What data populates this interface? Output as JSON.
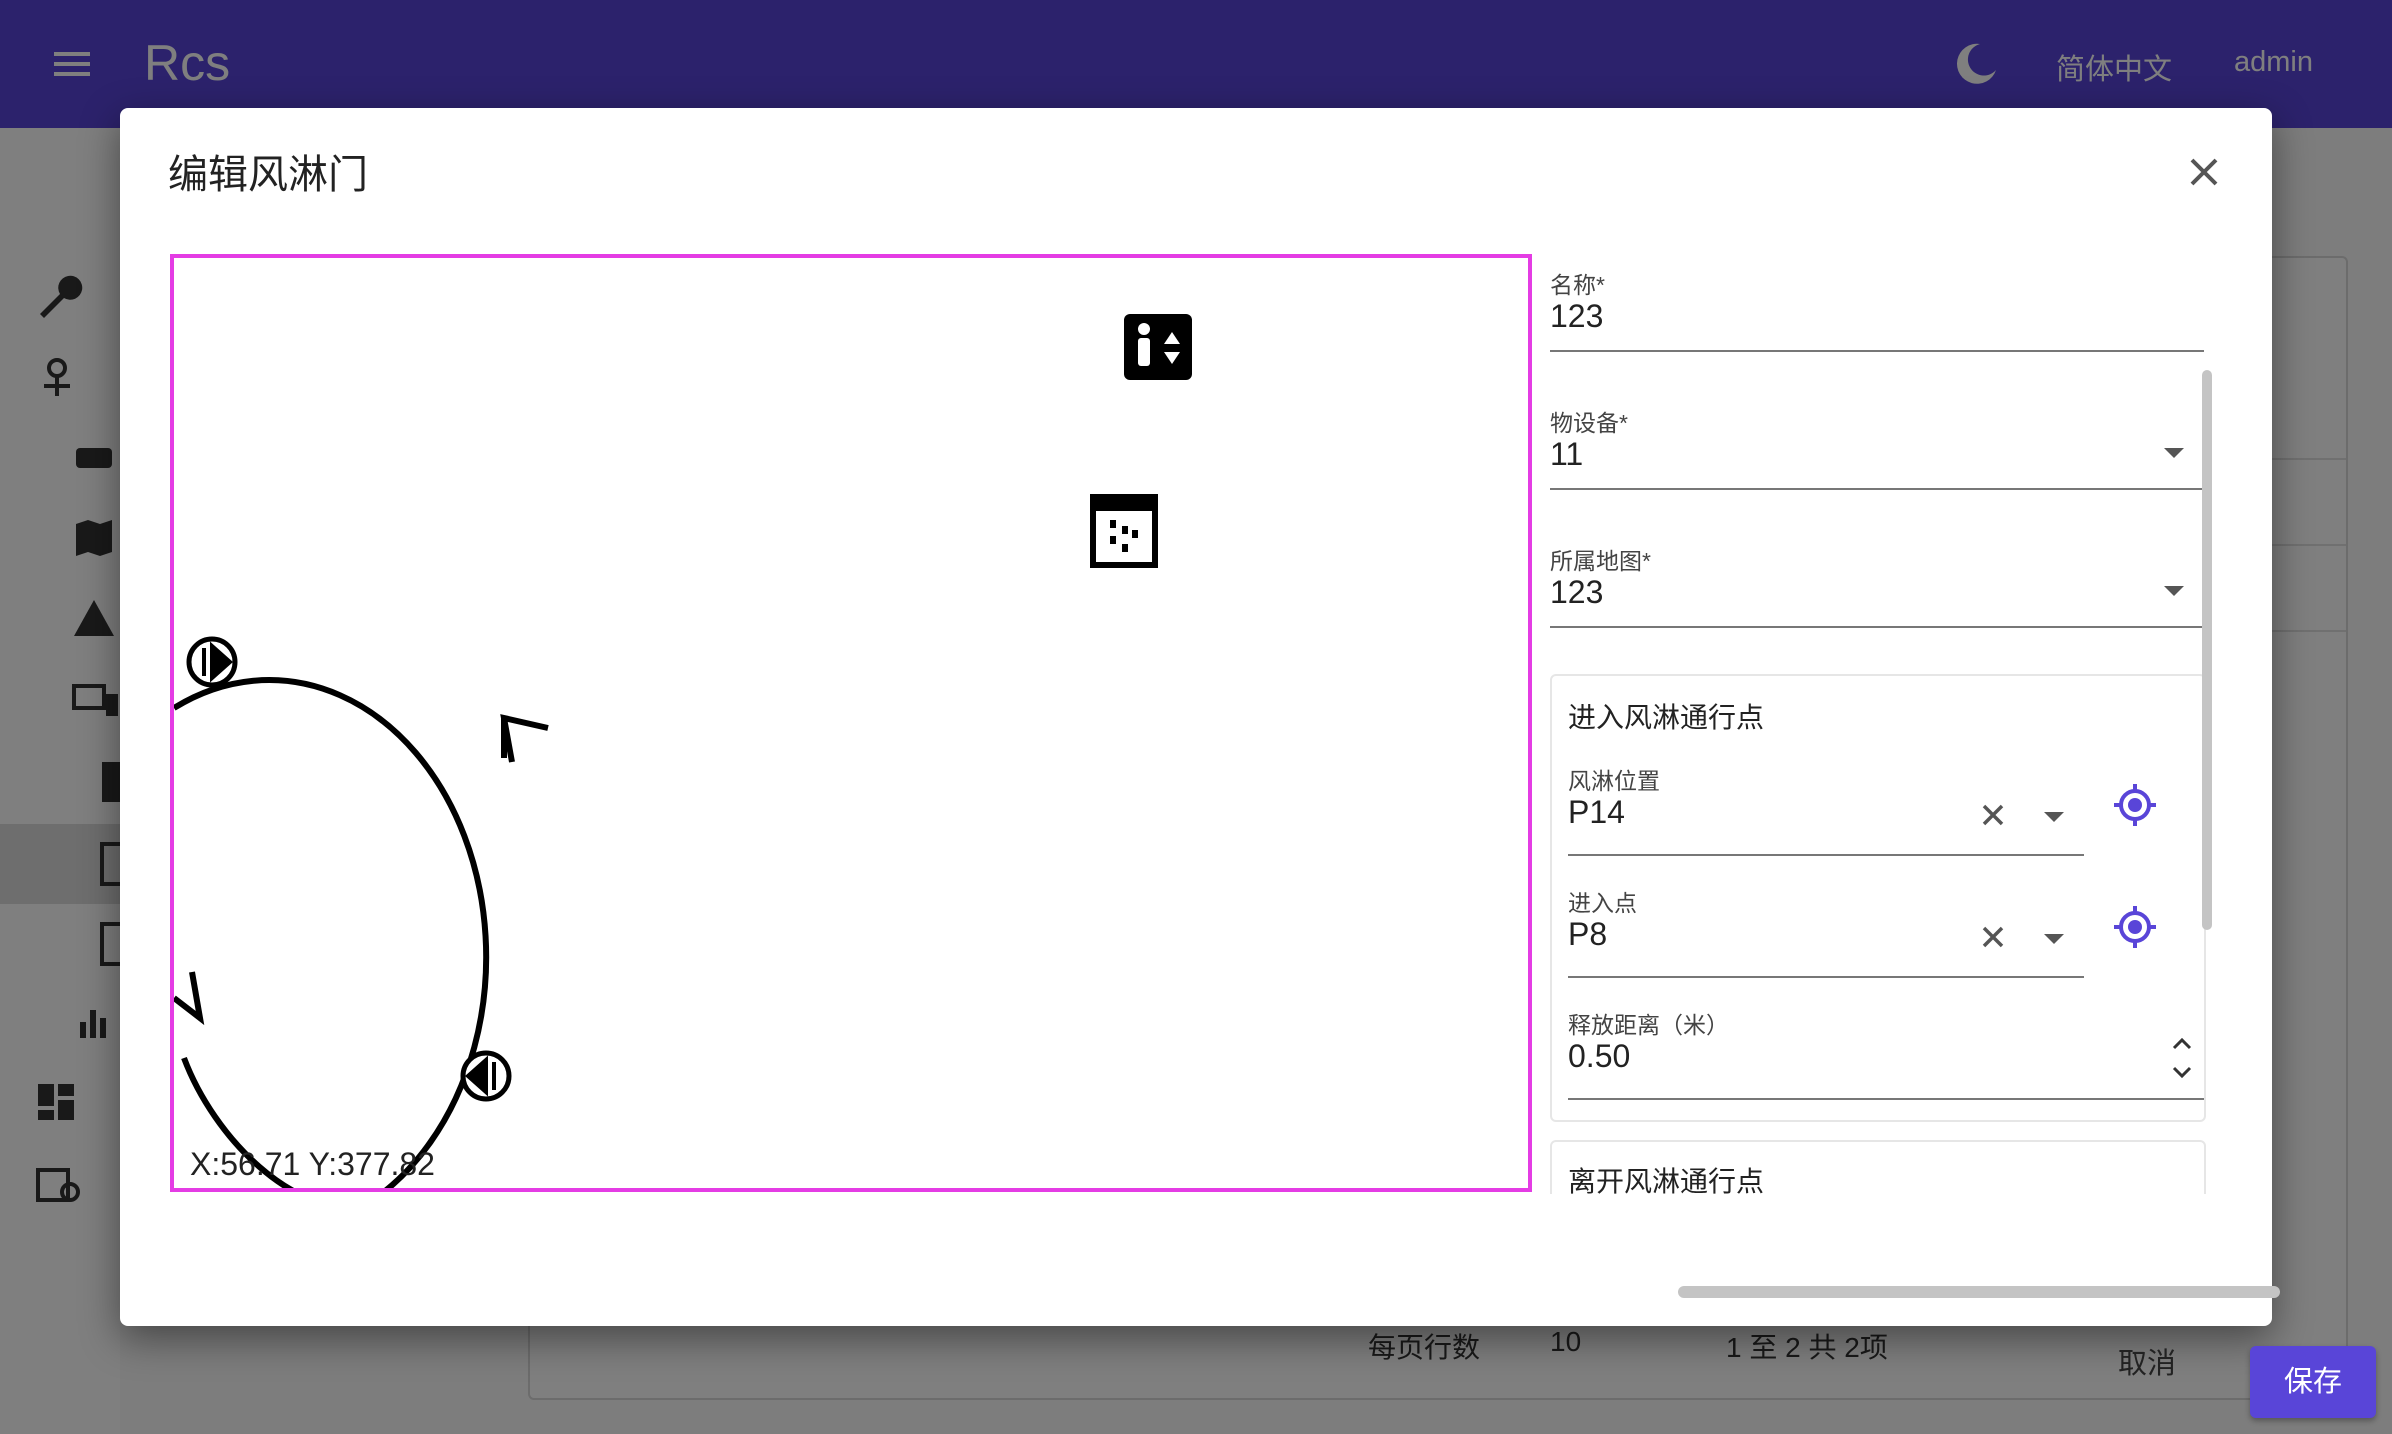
{
  "app": {
    "title": "Rcs",
    "language": "简体中文",
    "user": "admin"
  },
  "pager": {
    "rows_per_page_label": "每页行数",
    "rows_per_page": "10",
    "range": "1 至 2 共 2项"
  },
  "dialog": {
    "title": "编辑风淋门",
    "canvas": {
      "coordinates": "X:56.71 Y:377.82"
    },
    "form": {
      "name": {
        "label": "名称*",
        "value": "123"
      },
      "device": {
        "label": "物设备*",
        "value": "11"
      },
      "map": {
        "label": "所属地图*",
        "value": "123"
      },
      "enter_section": {
        "title": "进入风淋通行点",
        "position": {
          "label": "风淋位置",
          "value": "P14"
        },
        "entry_point": {
          "label": "进入点",
          "value": "P8"
        },
        "release_distance": {
          "label": "释放距离（米）",
          "value": "0.50"
        }
      },
      "next_section": {
        "title": "离开风淋通行点"
      }
    },
    "buttons": {
      "cancel": "取消",
      "save": "保存"
    }
  },
  "colors": {
    "primary": "#5945d8",
    "canvas_border": "#e43ce4",
    "text": "#222222"
  },
  "icons": [
    "menu-icon",
    "moon-icon",
    "close-icon",
    "elevator-icon",
    "air-shower-door-icon",
    "crosshair-target-icon",
    "clear-icon",
    "dropdown-arrow-icon"
  ]
}
